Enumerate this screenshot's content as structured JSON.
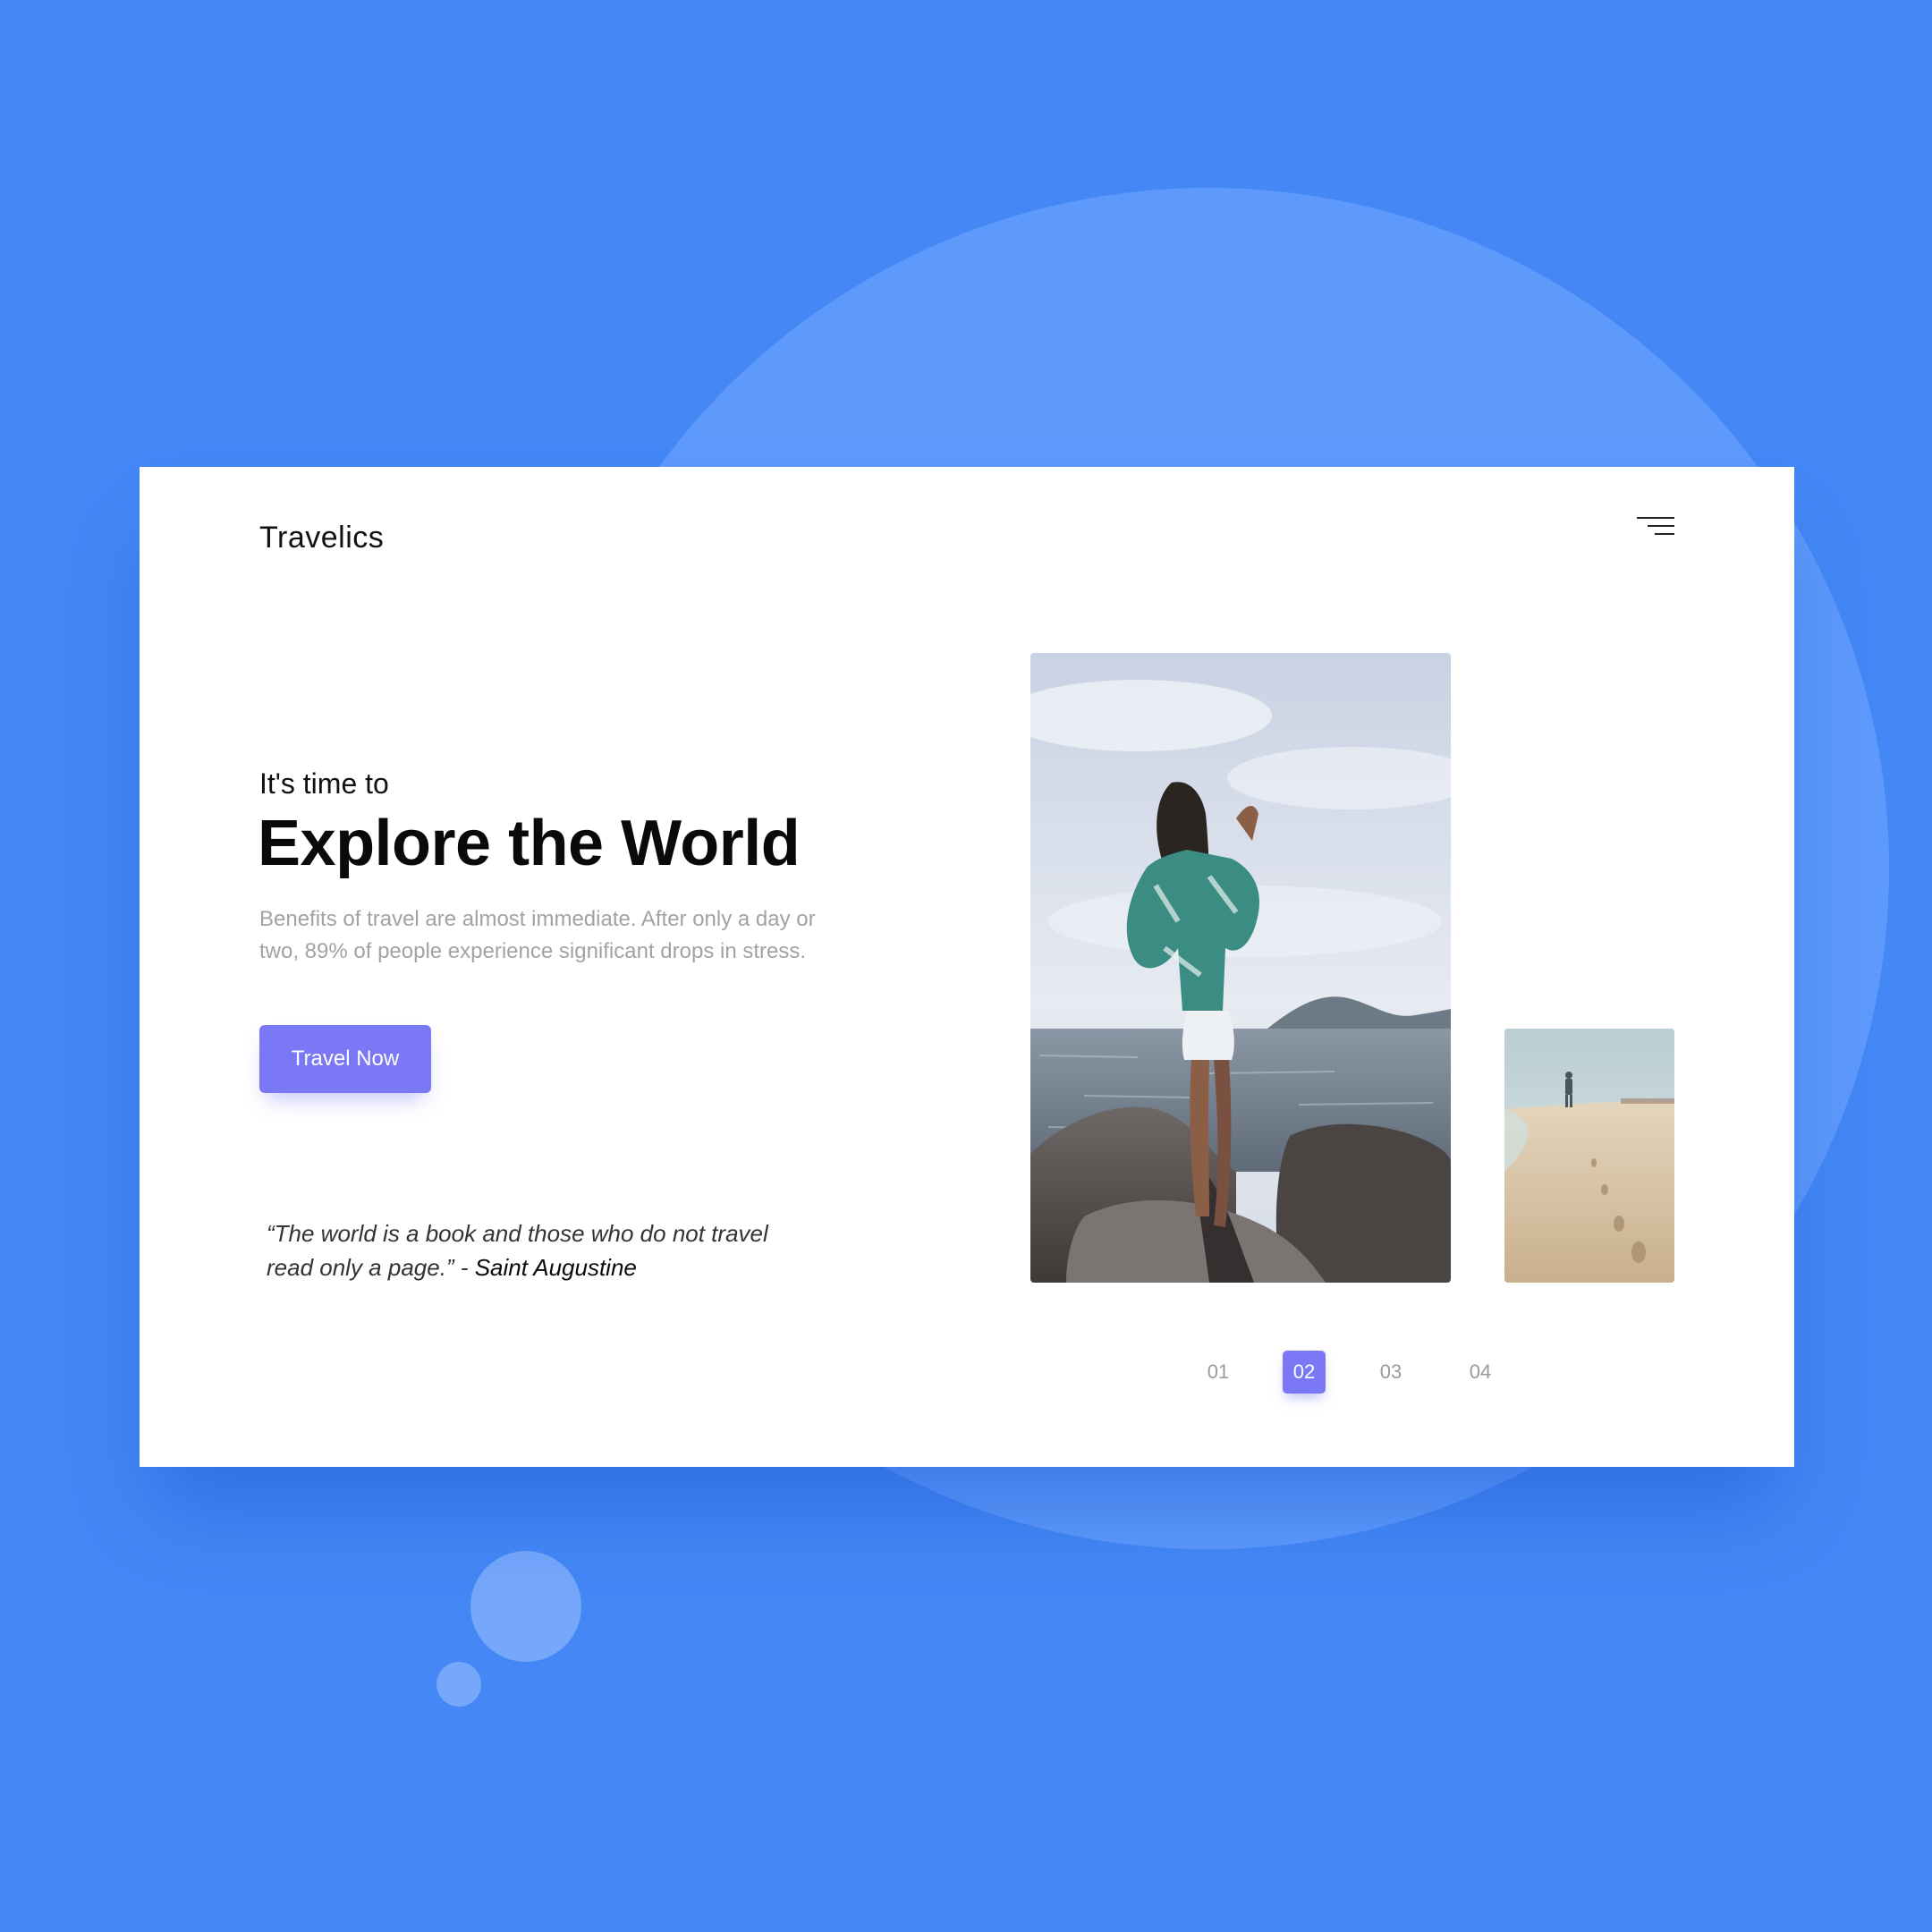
{
  "brand": {
    "name": "Travelics"
  },
  "hero": {
    "kicker": "It's time to",
    "headline": "Explore the World",
    "description": "Benefits of travel are almost immediate. After only a day or two, 89% of people experience significant drops in stress.",
    "cta_label": "Travel Now"
  },
  "quote": {
    "text": "“The world is a book and those who do not travel read only a page.” - ",
    "author": "Saint Augustine"
  },
  "gallery": {
    "main_photo": "woman-on-rocks-by-sea",
    "side_photo": "person-walking-on-beach"
  },
  "pagination": {
    "pages": [
      "01",
      "02",
      "03",
      "04"
    ],
    "active": "02"
  },
  "colors": {
    "background": "#4487F5",
    "accent": "#7B78F5",
    "card": "#FFFFFF"
  },
  "icons": {
    "menu": "hamburger-menu-icon"
  }
}
